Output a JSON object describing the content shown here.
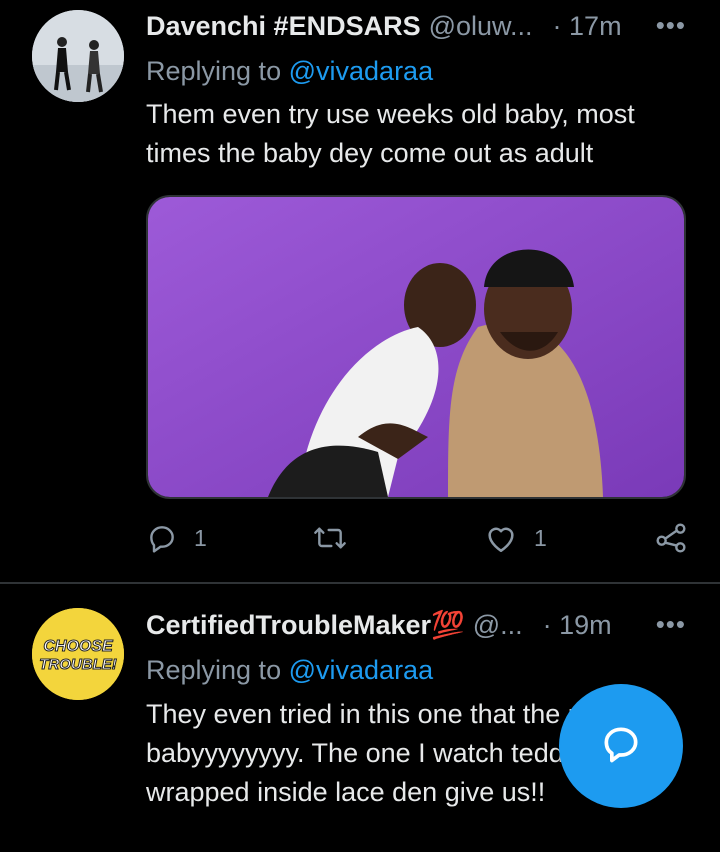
{
  "tweets": [
    {
      "author_name": "Davenchi #ENDSARS",
      "handle": "@oluw...",
      "time": "· 17m",
      "replying_prefix": "Replying to",
      "replying_to": "@vivadaraa",
      "text": "Them even try use weeks old baby, most times the baby dey come out as adult",
      "reply_count": "1",
      "retweet_count": "",
      "like_count": "1"
    },
    {
      "author_name": "CertifiedTroubleMaker💯",
      "handle": "@...",
      "time": "· 19m",
      "replying_prefix": "Replying to",
      "replying_to": "@vivadaraa",
      "text": "They even tried in this one that the real babyyyyyyyy. The one I watch teddy bear wrapped inside lace den give us!!",
      "avatar_text_line1": "CHOOSE",
      "avatar_text_line2": "TROUBLE!"
    }
  ],
  "more_glyph": "•••",
  "colors": {
    "background": "#000000",
    "text": "#e7e9ea",
    "muted": "#8b98a5",
    "accent": "#1d9bf0",
    "divider": "#2f3336"
  },
  "icons": [
    "reply-icon",
    "retweet-icon",
    "like-icon",
    "share-icon",
    "more-icon",
    "compose-reply-icon"
  ]
}
